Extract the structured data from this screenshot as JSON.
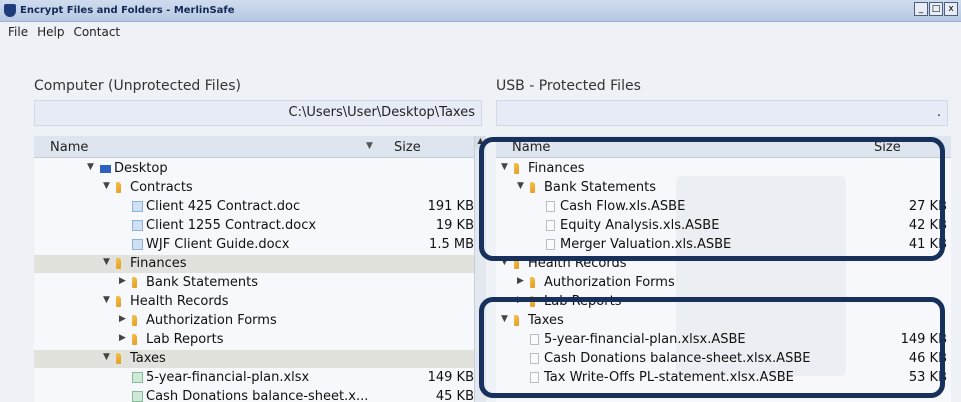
{
  "window": {
    "title": "Encrypt Files and Folders - MerlinSafe",
    "buttons": [
      "_",
      "□",
      "x"
    ]
  },
  "menu": [
    "File",
    "Help",
    "Contact"
  ],
  "left_pane": {
    "title": "Computer (Unprotected Files)",
    "path": "C:\\Users\\User\\Desktop\\Taxes",
    "columns": {
      "name": "Name",
      "size": "Size"
    },
    "rows": [
      {
        "label": "Desktop",
        "icon": "desktop-icon",
        "expanded": true,
        "size": ""
      },
      {
        "label": "Contracts",
        "icon": "folder-icon",
        "expanded": true,
        "size": ""
      },
      {
        "label": "Client 425 Contract.doc",
        "icon": "word-doc-icon",
        "size": "191 KB"
      },
      {
        "label": "Client 1255 Contract.docx",
        "icon": "word-doc-icon",
        "size": "19 KB"
      },
      {
        "label": "WJF Client Guide.docx",
        "icon": "word-doc-icon",
        "size": "1.5 MB"
      },
      {
        "label": "Finances",
        "icon": "folder-icon",
        "expanded": true,
        "highlighted": true,
        "size": ""
      },
      {
        "label": "Bank Statements",
        "icon": "folder-icon",
        "expanded": false,
        "size": ""
      },
      {
        "label": "Health Records",
        "icon": "folder-icon",
        "expanded": true,
        "size": ""
      },
      {
        "label": "Authorization Forms",
        "icon": "folder-icon",
        "expanded": false,
        "size": ""
      },
      {
        "label": "Lab Reports",
        "icon": "folder-icon",
        "expanded": false,
        "size": ""
      },
      {
        "label": "Taxes",
        "icon": "folder-icon",
        "expanded": true,
        "highlighted": true,
        "size": ""
      },
      {
        "label": "5-year-financial-plan.xlsx",
        "icon": "excel-icon",
        "size": "149 KB"
      },
      {
        "label": "Cash Donations balance-sheet.x...",
        "icon": "excel-icon",
        "size": "45 KB"
      }
    ]
  },
  "right_pane": {
    "title": "USB - Protected Files",
    "path": ".",
    "columns": {
      "name": "Name",
      "size": "Size"
    },
    "rows": [
      {
        "label": "Finances",
        "icon": "folder-icon",
        "expanded": true,
        "size": ""
      },
      {
        "label": "Bank Statements",
        "icon": "folder-icon",
        "expanded": true,
        "size": ""
      },
      {
        "label": "Cash Flow.xls.ASBE",
        "icon": "encrypted-file-icon",
        "size": "27 KB"
      },
      {
        "label": "Equity Analysis.xls.ASBE",
        "icon": "encrypted-file-icon",
        "size": "42 KB"
      },
      {
        "label": "Merger Valuation.xls.ASBE",
        "icon": "encrypted-file-icon",
        "size": "41 KB"
      },
      {
        "label": "Health Records",
        "icon": "folder-icon",
        "expanded": true,
        "size": ""
      },
      {
        "label": "Authorization Forms",
        "icon": "folder-icon",
        "expanded": false,
        "size": ""
      },
      {
        "label": "Lab Reports",
        "icon": "folder-icon",
        "expanded": false,
        "size": ""
      },
      {
        "label": "Taxes",
        "icon": "folder-icon",
        "expanded": true,
        "size": ""
      },
      {
        "label": "5-year-financial-plan.xlsx.ASBE",
        "icon": "encrypted-file-icon",
        "size": "149 KB"
      },
      {
        "label": "Cash Donations balance-sheet.xlsx.ASBE",
        "icon": "encrypted-file-icon",
        "size": "46 KB"
      },
      {
        "label": "Tax Write-Offs PL-statement.xlsx.ASBE",
        "icon": "encrypted-file-icon",
        "size": "53 KB"
      }
    ]
  },
  "colors": {
    "callout_border": "#17305c",
    "pane_highlight": "#e2e2dc",
    "title_bar": "#b7c8e2"
  }
}
